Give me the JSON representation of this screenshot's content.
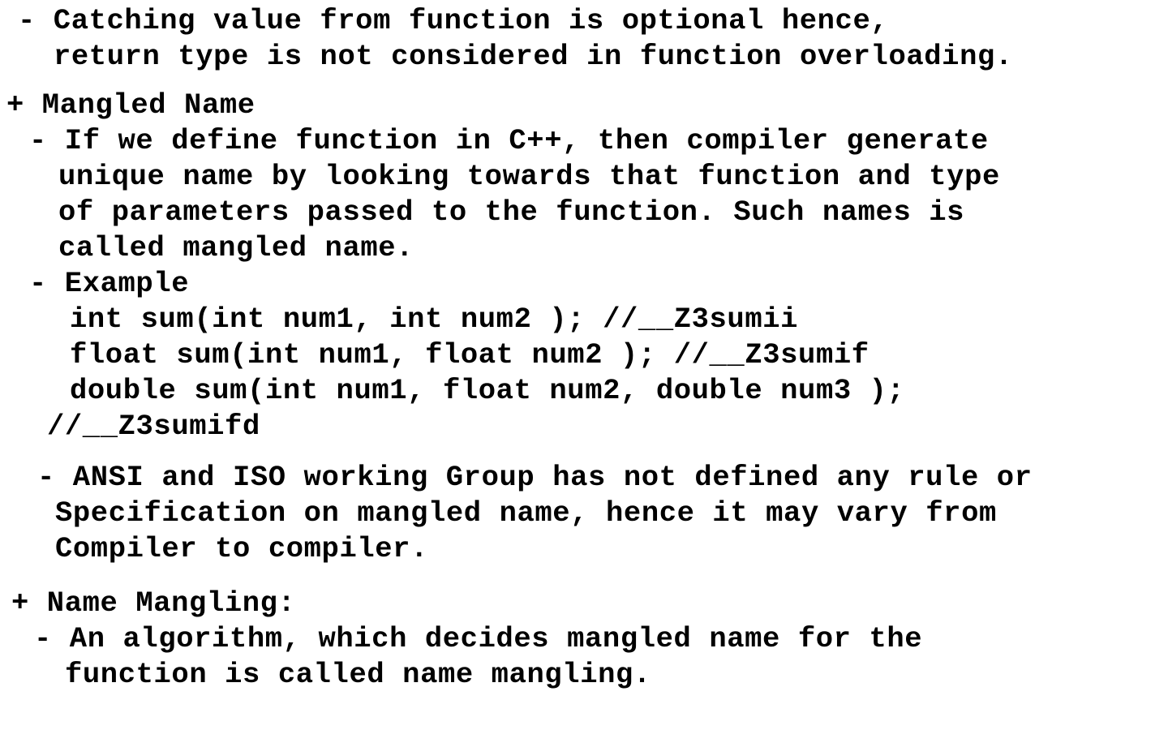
{
  "notes": {
    "block1": {
      "line1": "- Catching value from function is optional hence,",
      "line2": "return type is not considered in function overloading."
    },
    "mangled_name": {
      "heading": "+ Mangled Name",
      "definition": {
        "line1": "- If we define function in C++, then compiler generate",
        "line2": "unique name by looking towards that function and type",
        "line3": "of parameters passed to the function. Such names is",
        "line4": "called mangled name."
      },
      "example": {
        "label": "- Example",
        "code1": "int sum(int num1, int num2 ); //__Z3sumii",
        "code2": "float sum(int num1, float num2 ); //__Z3sumif",
        "code3": "double sum(int num1, float num2, double num3 );",
        "code3_comment": "//__Z3sumifd"
      },
      "standard": {
        "line1": "- ANSI and ISO working Group has not defined any rule or",
        "line2": "Specification on mangled name, hence it may vary from",
        "line3": "Compiler to compiler."
      }
    },
    "name_mangling": {
      "heading": "+ Name Mangling:",
      "line1": "- An algorithm, which decides mangled name for the",
      "line2": "function is called name mangling."
    }
  }
}
